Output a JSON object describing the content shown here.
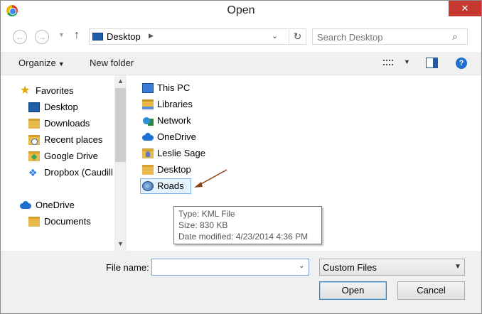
{
  "window": {
    "title": "Open",
    "app_icon": "chrome-icon",
    "close_glyph": "✕"
  },
  "navbar": {
    "back_glyph": "←",
    "forward_glyph": "→",
    "history_glyph": "▼",
    "up_glyph": "↑",
    "address": "Desktop",
    "address_sep": "▶",
    "address_drop": "⌄",
    "refresh_glyph": "↻",
    "search_placeholder": "Search Desktop",
    "search_glyph": "⌕"
  },
  "toolbar": {
    "organize_label": "Organize",
    "organize_drop": "▼",
    "new_folder_label": "New folder",
    "view_drop": "▼",
    "help_glyph": "?"
  },
  "nav_pane": {
    "items": [
      {
        "label": "Favorites",
        "icon": "star-icon"
      },
      {
        "label": "Desktop",
        "icon": "desktop-icon"
      },
      {
        "label": "Downloads",
        "icon": "downloads-folder-icon"
      },
      {
        "label": "Recent places",
        "icon": "recent-places-icon"
      },
      {
        "label": "Google Drive",
        "icon": "google-drive-icon"
      },
      {
        "label": "Dropbox (Caudill",
        "icon": "dropbox-icon"
      },
      {
        "label": "OneDrive",
        "icon": "onedrive-icon"
      },
      {
        "label": "Documents",
        "icon": "folder-icon"
      }
    ],
    "scroll_up": "▲",
    "scroll_down": "▼"
  },
  "files": {
    "items": [
      {
        "label": "This PC",
        "icon": "this-pc-icon"
      },
      {
        "label": "Libraries",
        "icon": "libraries-icon"
      },
      {
        "label": "Network",
        "icon": "network-icon"
      },
      {
        "label": "OneDrive",
        "icon": "onedrive-icon"
      },
      {
        "label": "Leslie Sage",
        "icon": "user-folder-icon"
      },
      {
        "label": "Desktop",
        "icon": "folder-icon"
      },
      {
        "label": "Roads",
        "icon": "kml-file-icon",
        "selected": true
      }
    ]
  },
  "tooltip": {
    "type": "Type: KML File",
    "size": "Size: 830 KB",
    "modified": "Date modified: 4/23/2014 4:36 PM"
  },
  "bottom": {
    "file_name_label": "File name:",
    "file_name_value": "",
    "file_name_drop": "⌄",
    "file_type_value": "Custom Files",
    "file_type_drop": "▼",
    "open_label": "Open",
    "cancel_label": "Cancel"
  },
  "colors": {
    "arrow": "#8b4513",
    "close": "#c7372f",
    "selection": "#e5f3ff"
  }
}
